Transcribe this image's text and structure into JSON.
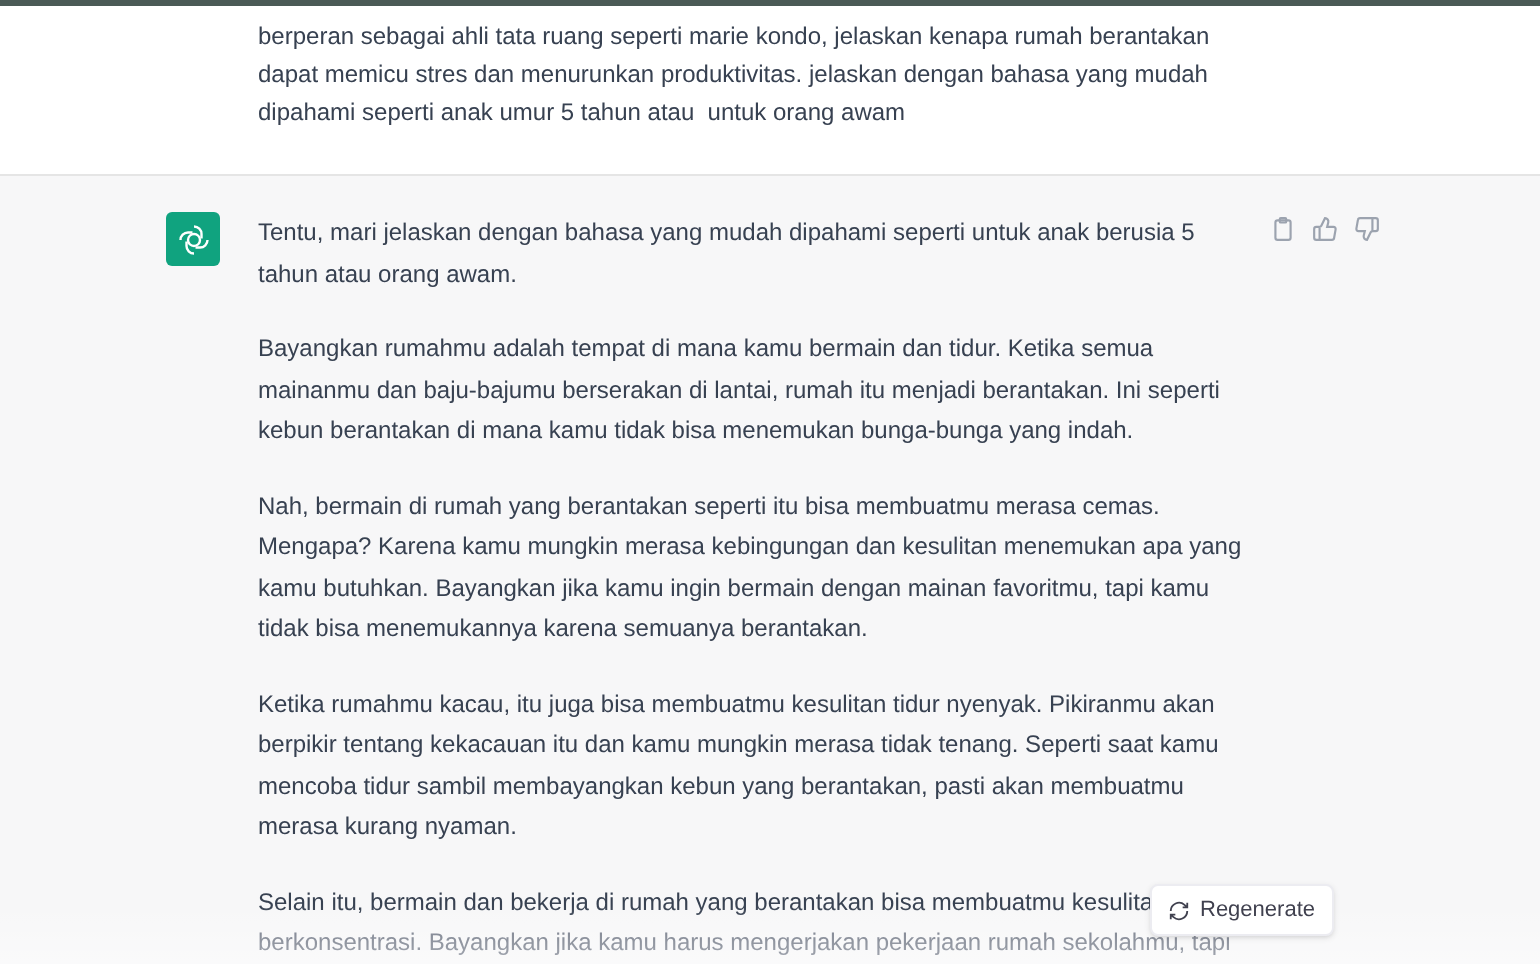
{
  "user_message": {
    "text": "berperan sebagai ahli tata ruang seperti marie kondo, jelaskan kenapa rumah berantakan dapat memicu stres dan menurunkan produktivitas. jelaskan dengan bahasa yang mudah dipahami seperti anak umur 5 tahun atau  untuk orang awam"
  },
  "assistant_message": {
    "paragraphs": [
      "Tentu, mari jelaskan dengan bahasa yang mudah dipahami seperti untuk anak berusia 5 tahun atau orang awam.",
      "Bayangkan rumahmu adalah tempat di mana kamu bermain dan tidur. Ketika semua mainanmu dan baju-bajumu berserakan di lantai, rumah itu menjadi berantakan. Ini seperti kebun berantakan di mana kamu tidak bisa menemukan bunga-bunga yang indah.",
      "Nah, bermain di rumah yang berantakan seperti itu bisa membuatmu merasa cemas. Mengapa? Karena kamu mungkin merasa kebingungan dan kesulitan menemukan apa yang kamu butuhkan. Bayangkan jika kamu ingin bermain dengan mainan favoritmu, tapi kamu tidak bisa menemukannya karena semuanya berantakan.",
      "Ketika rumahmu kacau, itu juga bisa membuatmu kesulitan tidur nyenyak. Pikiranmu akan berpikir tentang kekacauan itu dan kamu mungkin merasa tidak tenang. Seperti saat kamu mencoba tidur sambil membayangkan kebun yang berantakan, pasti akan membuatmu merasa kurang nyaman."
    ],
    "cut_lines": [
      "Selain itu, bermain dan bekerja di rumah yang berantakan bisa membuatmu kesulita",
      "berkonsentrasi. Bayangkan jika kamu harus mengerjakan pekerjaan rumah sekolahmu, tapi"
    ]
  },
  "regenerate_button": {
    "label": "Regenerate"
  }
}
